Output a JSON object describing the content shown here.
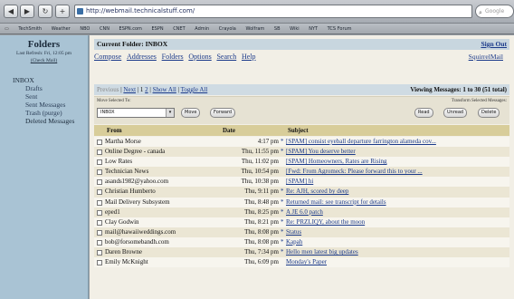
{
  "browser": {
    "nav_buttons": [
      "◀",
      "▶",
      "↻",
      "+"
    ],
    "url": "http://webmail.technicalstuff.com/",
    "search_placeholder": "Google",
    "bookmarks": [
      "TechSmith",
      "Weather",
      "NBO",
      "CNN",
      "ESPN.com",
      "ESPN",
      "CNET",
      "Admin",
      "Crayola",
      "Wolfram",
      "SB",
      "Wiki",
      "NYT",
      "TCS Forum"
    ]
  },
  "sidebar": {
    "title": "Folders",
    "last_refresh": "Last Refresh: Fri, 12:05 pm",
    "check_mail": "(Check Mail)",
    "inbox": "INBOX",
    "subfolders": [
      "Drafts",
      "Sent",
      "Sent Messages",
      "Trash (purge)"
    ],
    "deleted": "Deleted Messages"
  },
  "main": {
    "current_folder": "Current Folder: INBOX",
    "sign_out": "Sign Out",
    "nav": [
      "Compose",
      "Addresses",
      "Folders",
      "Options",
      "Search",
      "Help"
    ],
    "brand": "SquirrelMail",
    "pager": {
      "previous": "Previous",
      "next": "Next",
      "pages": [
        "1",
        "2"
      ],
      "show_all": "Show All",
      "toggle_all": "Toggle All",
      "viewing": "Viewing Messages: 1 to 30 (51 total)"
    },
    "move": {
      "label": "Move Selected To:",
      "selected": "INBOX",
      "move_btn": "Move",
      "forward_btn": "Forward",
      "transform_label": "Transform Selected Messages:",
      "read_btn": "Read",
      "unread_btn": "Unread",
      "delete_btn": "Delete"
    },
    "columns": {
      "from": "From",
      "date": "Date",
      "subject": "Subject"
    },
    "messages": [
      {
        "from": "Martha Morse",
        "date": "4:17 pm",
        "star": "*",
        "subject": "[SPAM] consist eyeball departure farrington alameda cov..."
      },
      {
        "from": "Online Degree - canada",
        "date": "Thu, 11:55 pm",
        "star": "*",
        "subject": "[SPAM] You deserve better"
      },
      {
        "from": "Low Rates",
        "date": "Thu, 11:02 pm",
        "star": "",
        "subject": "[SPAM] Homeowners, Rates are Rising"
      },
      {
        "from": "Technician News",
        "date": "Thu, 10:54 pm",
        "star": "",
        "subject": "[Fwd: From Agromeck: Please forward this to your ..."
      },
      {
        "from": "asands1982@yahoo.com",
        "date": "Thu, 10:38 pm",
        "star": "",
        "subject": "[SPAM] hi"
      },
      {
        "from": "Christian Humberto",
        "date": "Thu, 9:11 pm",
        "star": "*",
        "subject": "Re: AJH, scored by deep"
      },
      {
        "from": "Mail Delivery Subsystem",
        "date": "Thu, 8:48 pm",
        "star": "*",
        "subject": "Returned mail: see transcript for details"
      },
      {
        "from": "eped1",
        "date": "Thu, 8:25 pm",
        "star": "*",
        "subject": "A JE 6.0 patch"
      },
      {
        "from": "Clay Godwin",
        "date": "Thu, 8:21 pm",
        "star": "*",
        "subject": "Re: PRZLIQY, about the moon"
      },
      {
        "from": "mail@hawaiiweddings.com",
        "date": "Thu, 8:08 pm",
        "star": "*",
        "subject": "Status"
      },
      {
        "from": "bob@forsomebandh.com",
        "date": "Thu, 8:08 pm",
        "star": "*",
        "subject": "Kapah"
      },
      {
        "from": "Daren Browne",
        "date": "Thu, 7:34 pm",
        "star": "*",
        "subject": "Hello men latest big updates"
      },
      {
        "from": "Emily McKnight",
        "date": "Thu, 6:09 pm",
        "star": "",
        "subject": "Monday's Paper"
      }
    ]
  }
}
